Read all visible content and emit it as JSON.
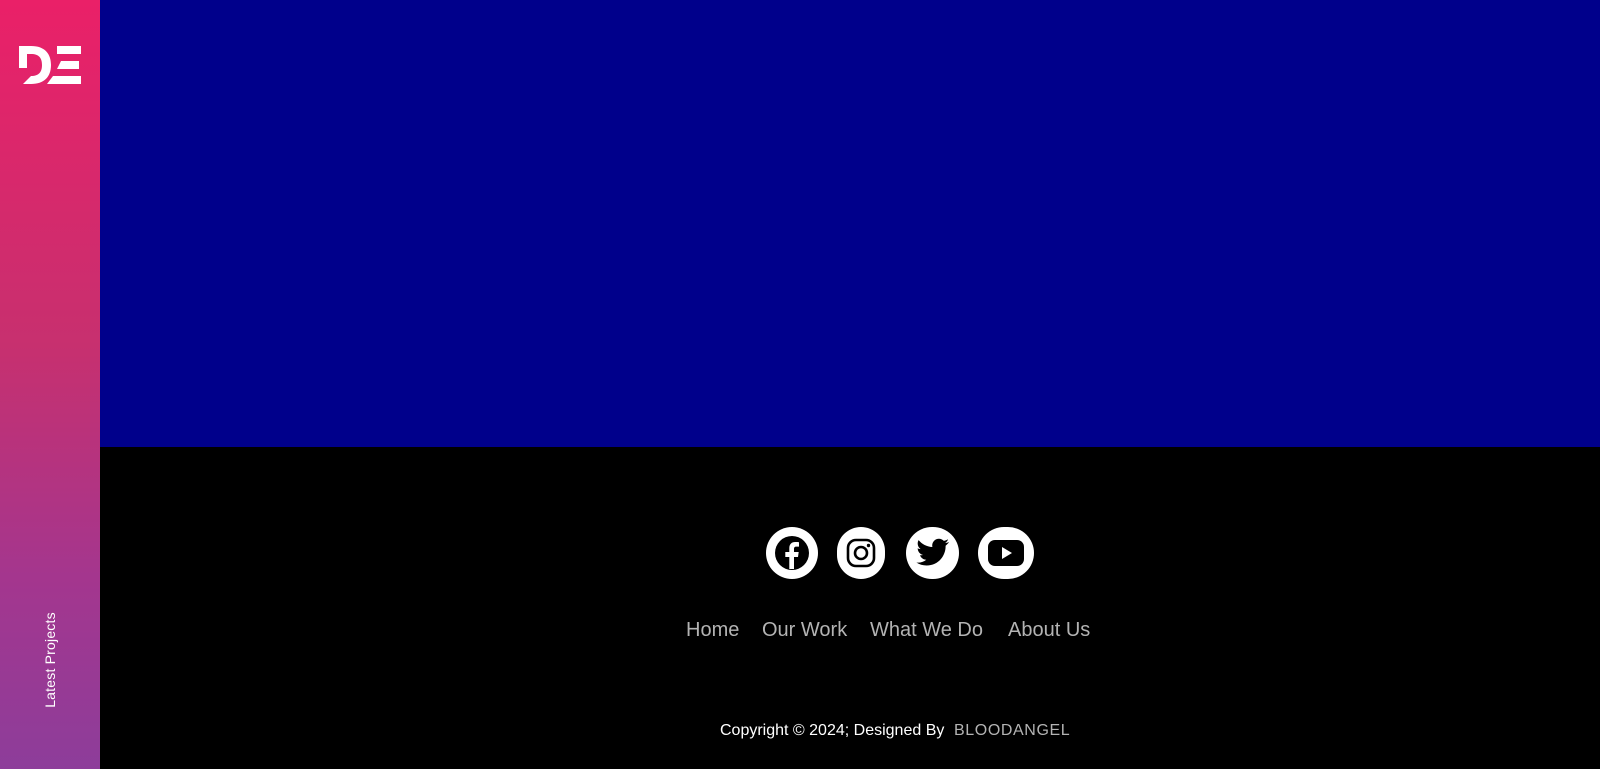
{
  "sidebar": {
    "logo_text": "DE",
    "vertical_label": "Latest Projects"
  },
  "colors": {
    "sidebar_top": "#ea2068",
    "sidebar_bottom": "#8d3d9a",
    "hero_background": "#00008b",
    "footer_background": "#000000",
    "link_color": "#b3b3b3"
  },
  "footer": {
    "social_icons": [
      "facebook-icon",
      "instagram-icon",
      "twitter-icon",
      "youtube-icon"
    ],
    "nav": {
      "home": "Home",
      "our_work": "Our Work",
      "what_we_do": "What We Do",
      "about_us": "About Us"
    },
    "copyright": "Copyright © 2024; Designed By",
    "designer": "BLOODANGEL"
  }
}
